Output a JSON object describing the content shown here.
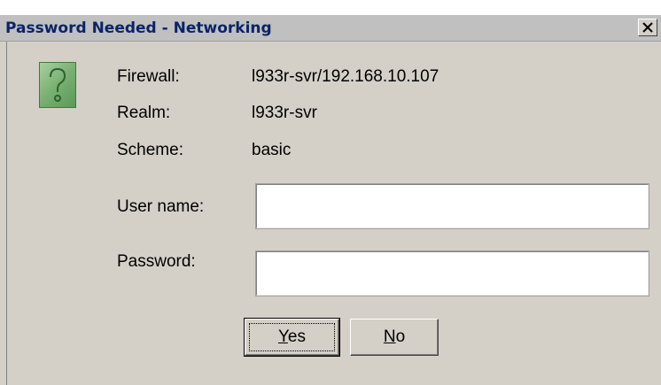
{
  "window": {
    "title": "Password Needed - Networking",
    "close_icon": "close-icon"
  },
  "icon": {
    "name": "help-question-icon",
    "glyph": "?",
    "color": "#78b070"
  },
  "info": {
    "firewall_label": "Firewall:",
    "firewall_value": "l933r-svr/192.168.10.107",
    "realm_label": "Realm:",
    "realm_value": "l933r-svr",
    "scheme_label": "Scheme:",
    "scheme_value": "basic"
  },
  "form": {
    "username_label": "User name:",
    "username_value": "",
    "password_label": "Password:",
    "password_value": ""
  },
  "buttons": {
    "yes_mnemonic": "Y",
    "yes_rest": "es",
    "no_mnemonic": "N",
    "no_rest": "o"
  },
  "colors": {
    "title_text": "#0a246a",
    "dialog_bg": "#d4d0c8"
  }
}
